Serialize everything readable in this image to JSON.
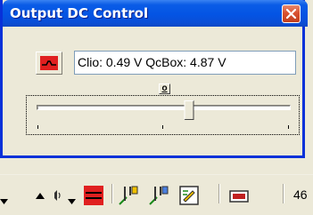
{
  "window": {
    "title": "Output DC Control"
  },
  "display": {
    "text": "Clio: 0.49 V QcBox: 4.87 V"
  },
  "small_button": {
    "label": "o"
  },
  "slider": {
    "position": 0.6
  },
  "toolbar": {
    "number_text": "46"
  },
  "colors": {
    "title_blue": "#0454e4",
    "close_red": "#d9512f",
    "signal_red": "#e02020"
  }
}
